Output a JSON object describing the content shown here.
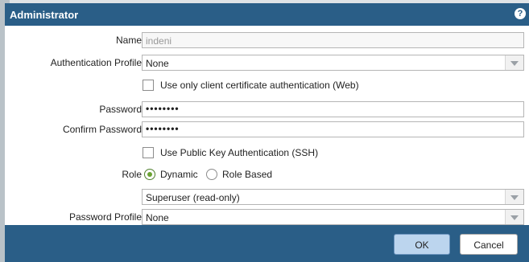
{
  "dialog": {
    "title": "Administrator",
    "help_icon": "?",
    "name": {
      "label": "Name",
      "value": "indeni"
    },
    "auth_profile": {
      "label": "Authentication Profile",
      "value": "None"
    },
    "client_cert": {
      "label": "Use only client certificate authentication (Web)",
      "checked": false
    },
    "password": {
      "label": "Password",
      "value": "••••••••"
    },
    "confirm_password": {
      "label": "Confirm Password",
      "value": "••••••••"
    },
    "public_key": {
      "label": "Use Public Key Authentication (SSH)",
      "checked": false
    },
    "role": {
      "label": "Role",
      "options": [
        "Dynamic",
        "Role Based"
      ],
      "selected": "Dynamic"
    },
    "role_select": {
      "value": "Superuser (read-only)"
    },
    "password_profile": {
      "label": "Password Profile",
      "value": "None"
    }
  },
  "footer": {
    "ok_label": "OK",
    "cancel_label": "Cancel"
  },
  "colors": {
    "titlebar": "#2a5e87",
    "ok_button": "#bcd5ee",
    "radio_selected": "#6aa332"
  }
}
